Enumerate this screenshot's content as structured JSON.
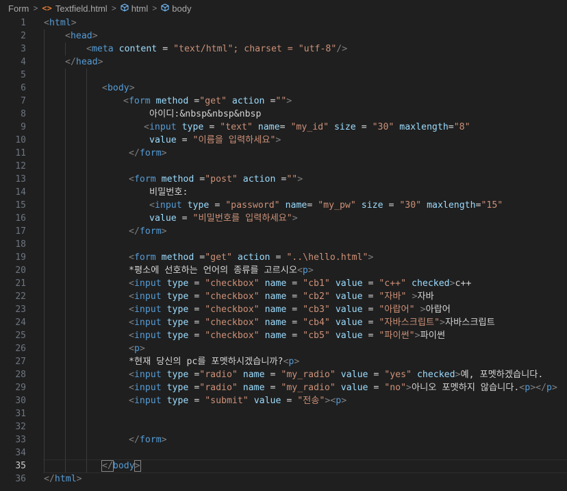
{
  "breadcrumb": {
    "items": [
      "Form",
      "Textfield.html",
      "html",
      "body"
    ],
    "separator": ">"
  },
  "editor": {
    "active_line": 35,
    "colors": {
      "background": "#1f1f1f",
      "tag": "#569cd6",
      "punct": "#808080",
      "attr": "#9cdcfe",
      "string": "#ce9178",
      "text": "#d4d4d4",
      "line_number": "#6e7681"
    },
    "lines": [
      {
        "n": "1",
        "tokens": [
          [
            "p",
            "<"
          ],
          [
            "t",
            "html"
          ],
          [
            "p",
            ">"
          ]
        ]
      },
      {
        "n": "2",
        "tokens": [
          [
            "p",
            "<"
          ],
          [
            "t",
            "head"
          ],
          [
            "p",
            ">"
          ]
        ]
      },
      {
        "n": "3",
        "tokens": [
          [
            "p",
            "<"
          ],
          [
            "t",
            "meta"
          ],
          [
            "x",
            " "
          ],
          [
            "a",
            "content"
          ],
          [
            "x",
            " = "
          ],
          [
            "s",
            "\"text/html\"; charset = \"utf-8\""
          ],
          [
            "p",
            "/>"
          ]
        ]
      },
      {
        "n": "4",
        "tokens": [
          [
            "p",
            "</"
          ],
          [
            "t",
            "head"
          ],
          [
            "p",
            ">"
          ]
        ]
      },
      {
        "n": "5",
        "tokens": []
      },
      {
        "n": "6",
        "tokens": [
          [
            "p",
            "<"
          ],
          [
            "t",
            "body"
          ],
          [
            "p",
            ">"
          ]
        ]
      },
      {
        "n": "7",
        "tokens": [
          [
            "p",
            "<"
          ],
          [
            "t",
            "form"
          ],
          [
            "x",
            " "
          ],
          [
            "a",
            "method"
          ],
          [
            "x",
            " ="
          ],
          [
            "s",
            "\"get\""
          ],
          [
            "x",
            " "
          ],
          [
            "a",
            "action"
          ],
          [
            "x",
            " ="
          ],
          [
            "s",
            "\"\""
          ],
          [
            "p",
            ">"
          ]
        ]
      },
      {
        "n": "8",
        "tokens": [
          [
            "x",
            "아이디:&nbsp&nbsp&nbsp"
          ]
        ]
      },
      {
        "n": "9",
        "tokens": [
          [
            "p",
            "<"
          ],
          [
            "t",
            "input"
          ],
          [
            "x",
            " "
          ],
          [
            "a",
            "type"
          ],
          [
            "x",
            " = "
          ],
          [
            "s",
            "\"text\""
          ],
          [
            "x",
            " "
          ],
          [
            "a",
            "name"
          ],
          [
            "x",
            "= "
          ],
          [
            "s",
            "\"my_id\""
          ],
          [
            "x",
            " "
          ],
          [
            "a",
            "size"
          ],
          [
            "x",
            " = "
          ],
          [
            "s",
            "\"30\""
          ],
          [
            "x",
            " "
          ],
          [
            "a",
            "maxlength"
          ],
          [
            "x",
            "="
          ],
          [
            "s",
            "\"8\""
          ]
        ]
      },
      {
        "n": "10",
        "tokens": [
          [
            "a",
            "value"
          ],
          [
            "x",
            " = "
          ],
          [
            "s",
            "\"이름을 입력하세요\""
          ],
          [
            "p",
            ">"
          ]
        ]
      },
      {
        "n": "11",
        "tokens": [
          [
            "p",
            "</"
          ],
          [
            "t",
            "form"
          ],
          [
            "p",
            ">"
          ]
        ]
      },
      {
        "n": "12",
        "tokens": []
      },
      {
        "n": "13",
        "tokens": [
          [
            "p",
            "<"
          ],
          [
            "t",
            "form"
          ],
          [
            "x",
            " "
          ],
          [
            "a",
            "method"
          ],
          [
            "x",
            " ="
          ],
          [
            "s",
            "\"post\""
          ],
          [
            "x",
            " "
          ],
          [
            "a",
            "action"
          ],
          [
            "x",
            " ="
          ],
          [
            "s",
            "\"\""
          ],
          [
            "p",
            ">"
          ]
        ]
      },
      {
        "n": "14",
        "tokens": [
          [
            "x",
            "비밀번호:"
          ]
        ]
      },
      {
        "n": "15",
        "tokens": [
          [
            "p",
            "<"
          ],
          [
            "t",
            "input"
          ],
          [
            "x",
            " "
          ],
          [
            "a",
            "type"
          ],
          [
            "x",
            " = "
          ],
          [
            "s",
            "\"password\""
          ],
          [
            "x",
            " "
          ],
          [
            "a",
            "name"
          ],
          [
            "x",
            "= "
          ],
          [
            "s",
            "\"my_pw\""
          ],
          [
            "x",
            " "
          ],
          [
            "a",
            "size"
          ],
          [
            "x",
            " = "
          ],
          [
            "s",
            "\"30\""
          ],
          [
            "x",
            " "
          ],
          [
            "a",
            "maxlength"
          ],
          [
            "x",
            "="
          ],
          [
            "s",
            "\"15\""
          ]
        ]
      },
      {
        "n": "16",
        "tokens": [
          [
            "a",
            "value"
          ],
          [
            "x",
            " = "
          ],
          [
            "s",
            "\"비밀번호를 입력하세요\""
          ],
          [
            "p",
            ">"
          ]
        ]
      },
      {
        "n": "17",
        "tokens": [
          [
            "p",
            "</"
          ],
          [
            "t",
            "form"
          ],
          [
            "p",
            ">"
          ]
        ]
      },
      {
        "n": "18",
        "tokens": []
      },
      {
        "n": "19",
        "tokens": [
          [
            "p",
            "<"
          ],
          [
            "t",
            "form"
          ],
          [
            "x",
            " "
          ],
          [
            "a",
            "method"
          ],
          [
            "x",
            " ="
          ],
          [
            "s",
            "\"get\""
          ],
          [
            "x",
            " "
          ],
          [
            "a",
            "action"
          ],
          [
            "x",
            " = "
          ],
          [
            "s",
            "\"..\\hello.html\""
          ],
          [
            "p",
            ">"
          ]
        ]
      },
      {
        "n": "20",
        "tokens": [
          [
            "x",
            "*평소에 선호하는 언어의 종류를 고르시오"
          ],
          [
            "p",
            "<"
          ],
          [
            "t",
            "p"
          ],
          [
            "p",
            ">"
          ]
        ]
      },
      {
        "n": "21",
        "tokens": [
          [
            "p",
            "<"
          ],
          [
            "t",
            "input"
          ],
          [
            "x",
            " "
          ],
          [
            "a",
            "type"
          ],
          [
            "x",
            " = "
          ],
          [
            "s",
            "\"checkbox\""
          ],
          [
            "x",
            " "
          ],
          [
            "a",
            "name"
          ],
          [
            "x",
            " = "
          ],
          [
            "s",
            "\"cb1\""
          ],
          [
            "x",
            " "
          ],
          [
            "a",
            "value"
          ],
          [
            "x",
            " = "
          ],
          [
            "s",
            "\"c++\""
          ],
          [
            "x",
            " "
          ],
          [
            "a",
            "checked"
          ],
          [
            "p",
            ">"
          ],
          [
            "x",
            "c++"
          ]
        ]
      },
      {
        "n": "22",
        "tokens": [
          [
            "p",
            "<"
          ],
          [
            "t",
            "input"
          ],
          [
            "x",
            " "
          ],
          [
            "a",
            "type"
          ],
          [
            "x",
            " = "
          ],
          [
            "s",
            "\"checkbox\""
          ],
          [
            "x",
            " "
          ],
          [
            "a",
            "name"
          ],
          [
            "x",
            " = "
          ],
          [
            "s",
            "\"cb2\""
          ],
          [
            "x",
            " "
          ],
          [
            "a",
            "value"
          ],
          [
            "x",
            " = "
          ],
          [
            "s",
            "\"자바\""
          ],
          [
            "x",
            " "
          ],
          [
            "p",
            ">"
          ],
          [
            "x",
            "자바"
          ]
        ]
      },
      {
        "n": "23",
        "tokens": [
          [
            "p",
            "<"
          ],
          [
            "t",
            "input"
          ],
          [
            "x",
            " "
          ],
          [
            "a",
            "type"
          ],
          [
            "x",
            " = "
          ],
          [
            "s",
            "\"checkbox\""
          ],
          [
            "x",
            " "
          ],
          [
            "a",
            "name"
          ],
          [
            "x",
            " = "
          ],
          [
            "s",
            "\"cb3\""
          ],
          [
            "x",
            " "
          ],
          [
            "a",
            "value"
          ],
          [
            "x",
            " = "
          ],
          [
            "s",
            "\"아랍어\""
          ],
          [
            "x",
            " "
          ],
          [
            "p",
            ">"
          ],
          [
            "x",
            "아랍어"
          ]
        ]
      },
      {
        "n": "24",
        "tokens": [
          [
            "p",
            "<"
          ],
          [
            "t",
            "input"
          ],
          [
            "x",
            " "
          ],
          [
            "a",
            "type"
          ],
          [
            "x",
            " = "
          ],
          [
            "s",
            "\"checkbox\""
          ],
          [
            "x",
            " "
          ],
          [
            "a",
            "name"
          ],
          [
            "x",
            " = "
          ],
          [
            "s",
            "\"cb4\""
          ],
          [
            "x",
            " "
          ],
          [
            "a",
            "value"
          ],
          [
            "x",
            " = "
          ],
          [
            "s",
            "\"자바스크립트\""
          ],
          [
            "p",
            ">"
          ],
          [
            "x",
            "자바스크립트"
          ]
        ]
      },
      {
        "n": "25",
        "tokens": [
          [
            "p",
            "<"
          ],
          [
            "t",
            "input"
          ],
          [
            "x",
            " "
          ],
          [
            "a",
            "type"
          ],
          [
            "x",
            " = "
          ],
          [
            "s",
            "\"checkbox\""
          ],
          [
            "x",
            " "
          ],
          [
            "a",
            "name"
          ],
          [
            "x",
            " = "
          ],
          [
            "s",
            "\"cb5\""
          ],
          [
            "x",
            " "
          ],
          [
            "a",
            "value"
          ],
          [
            "x",
            " = "
          ],
          [
            "s",
            "\"파이썬\""
          ],
          [
            "p",
            ">"
          ],
          [
            "x",
            "파이썬"
          ]
        ]
      },
      {
        "n": "26",
        "tokens": [
          [
            "p",
            "<"
          ],
          [
            "t",
            "p"
          ],
          [
            "p",
            ">"
          ]
        ]
      },
      {
        "n": "27",
        "tokens": [
          [
            "x",
            "*현재 당신의 pc를 포멧하시겠습니까?"
          ],
          [
            "p",
            "<"
          ],
          [
            "t",
            "p"
          ],
          [
            "p",
            ">"
          ]
        ]
      },
      {
        "n": "28",
        "tokens": [
          [
            "p",
            "<"
          ],
          [
            "t",
            "input"
          ],
          [
            "x",
            " "
          ],
          [
            "a",
            "type"
          ],
          [
            "x",
            " ="
          ],
          [
            "s",
            "\"radio\""
          ],
          [
            "x",
            " "
          ],
          [
            "a",
            "name"
          ],
          [
            "x",
            " = "
          ],
          [
            "s",
            "\"my_radio\""
          ],
          [
            "x",
            " "
          ],
          [
            "a",
            "value"
          ],
          [
            "x",
            " = "
          ],
          [
            "s",
            "\"yes\""
          ],
          [
            "x",
            " "
          ],
          [
            "a",
            "checked"
          ],
          [
            "p",
            ">"
          ],
          [
            "x",
            "예, 포멧하겠습니다."
          ]
        ]
      },
      {
        "n": "29",
        "tokens": [
          [
            "p",
            "<"
          ],
          [
            "t",
            "input"
          ],
          [
            "x",
            " "
          ],
          [
            "a",
            "type"
          ],
          [
            "x",
            " ="
          ],
          [
            "s",
            "\"radio\""
          ],
          [
            "x",
            " "
          ],
          [
            "a",
            "name"
          ],
          [
            "x",
            " = "
          ],
          [
            "s",
            "\"my_radio\""
          ],
          [
            "x",
            " "
          ],
          [
            "a",
            "value"
          ],
          [
            "x",
            " = "
          ],
          [
            "s",
            "\"no\""
          ],
          [
            "p",
            ">"
          ],
          [
            "x",
            "아니오 포멧하지 않습니다."
          ],
          [
            "p",
            "<"
          ],
          [
            "t",
            "p"
          ],
          [
            "p",
            "></"
          ],
          [
            "t",
            "p"
          ],
          [
            "p",
            ">"
          ]
        ]
      },
      {
        "n": "30",
        "tokens": [
          [
            "p",
            "<"
          ],
          [
            "t",
            "input"
          ],
          [
            "x",
            " "
          ],
          [
            "a",
            "type"
          ],
          [
            "x",
            " = "
          ],
          [
            "s",
            "\"submit\""
          ],
          [
            "x",
            " "
          ],
          [
            "a",
            "value"
          ],
          [
            "x",
            " = "
          ],
          [
            "s",
            "\"전송\""
          ],
          [
            "p",
            ">"
          ],
          [
            "p",
            "<"
          ],
          [
            "t",
            "p"
          ],
          [
            "p",
            ">"
          ]
        ]
      },
      {
        "n": "31",
        "tokens": []
      },
      {
        "n": "32",
        "tokens": []
      },
      {
        "n": "33",
        "tokens": [
          [
            "p",
            "</"
          ],
          [
            "t",
            "form"
          ],
          [
            "p",
            ">"
          ]
        ]
      },
      {
        "n": "34",
        "tokens": []
      },
      {
        "n": "35",
        "tokens": [
          [
            "p",
            "</"
          ],
          [
            "t",
            "body"
          ],
          [
            "p",
            ">"
          ]
        ]
      },
      {
        "n": "36",
        "tokens": [
          [
            "p",
            "</"
          ],
          [
            "t",
            "html"
          ],
          [
            "p",
            ">"
          ]
        ]
      }
    ]
  }
}
